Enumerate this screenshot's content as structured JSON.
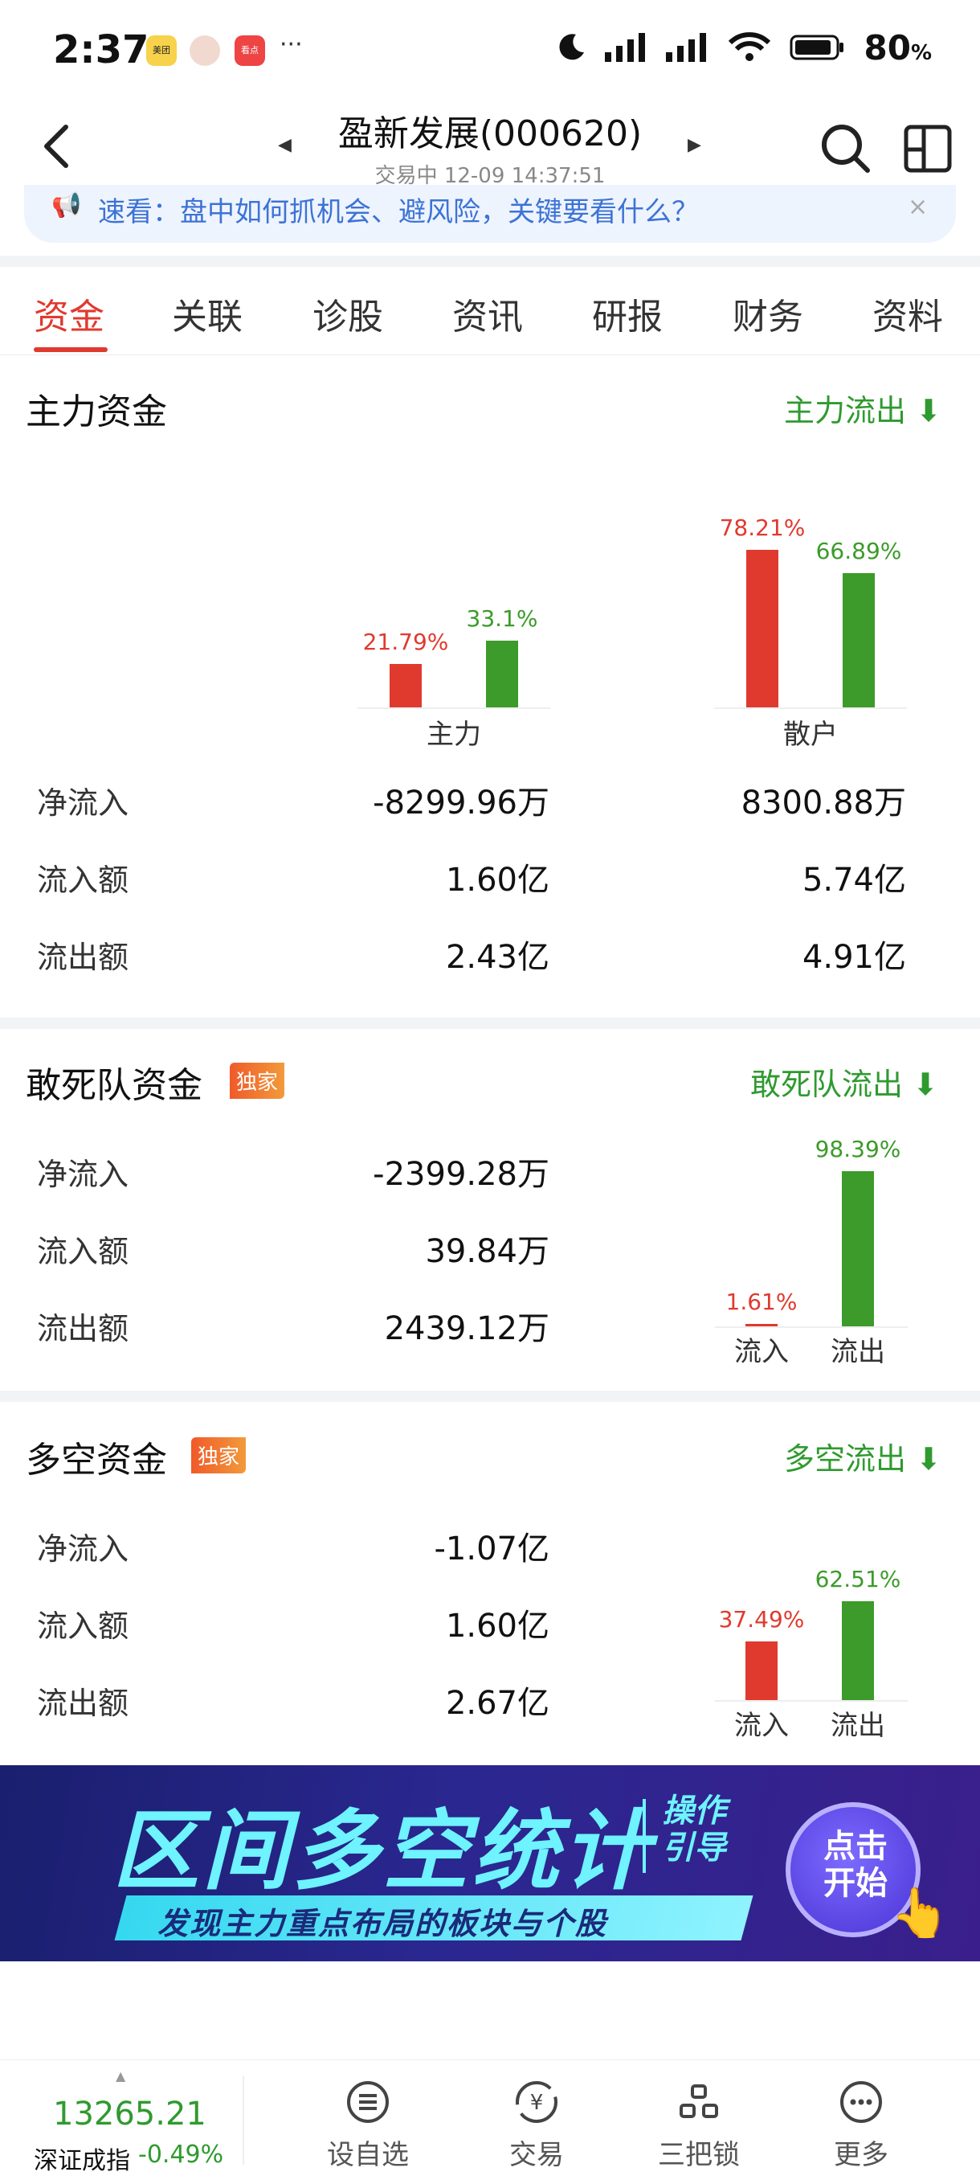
{
  "status_bar": {
    "time": "2:37",
    "notifications": [
      "美团",
      "看点"
    ],
    "more": "···",
    "battery": "80",
    "battery_unit": "%"
  },
  "header": {
    "title": "盈新发展(000620)",
    "subtitle": "交易中 12-09 14:37:51"
  },
  "notice": {
    "text": "速看：盘中如何抓机会、避风险，关键要看什么？"
  },
  "tabs": [
    "资金",
    "关联",
    "诊股",
    "资讯",
    "研报",
    "财务",
    "资料"
  ],
  "active_tab": 0,
  "main_funds": {
    "title": "主力资金",
    "link": "主力流出",
    "rows": [
      {
        "label": "净流入",
        "main": "-8299.96万",
        "retail": "8300.88万"
      },
      {
        "label": "流入额",
        "main": "1.60亿",
        "retail": "5.74亿"
      },
      {
        "label": "流出额",
        "main": "2.43亿",
        "retail": "4.91亿"
      }
    ]
  },
  "dare_funds": {
    "title": "敢死队资金",
    "badge": "独家",
    "link": "敢死队流出",
    "rows": [
      {
        "label": "净流入",
        "value": "-2399.28万"
      },
      {
        "label": "流入额",
        "value": "39.84万"
      },
      {
        "label": "流出额",
        "value": "2439.12万"
      }
    ]
  },
  "long_short_funds": {
    "title": "多空资金",
    "badge": "独家",
    "link": "多空流出",
    "rows": [
      {
        "label": "净流入",
        "value": "-1.07亿"
      },
      {
        "label": "流入额",
        "value": "1.60亿"
      },
      {
        "label": "流出额",
        "value": "2.67亿"
      }
    ]
  },
  "chart_data": [
    {
      "type": "bar",
      "categories": [
        "主力",
        "散户"
      ],
      "series": [
        {
          "values": [
            21.79,
            78.21
          ],
          "labels": [
            "21.79%",
            "78.21%"
          ],
          "color": "#e03a2f"
        },
        {
          "values": [
            33.1,
            66.89
          ],
          "labels": [
            "33.1%",
            "66.89%"
          ],
          "color": "#3c9b2a"
        }
      ],
      "ylim": [
        0,
        80
      ]
    },
    {
      "type": "bar",
      "categories": [
        "流入",
        "流出"
      ],
      "values": [
        1.61,
        98.39
      ],
      "labels": [
        "1.61%",
        "98.39%"
      ],
      "colors": [
        "#e03a2f",
        "#3c9b2a"
      ],
      "ylim": [
        0,
        100
      ]
    },
    {
      "type": "bar",
      "categories": [
        "流入",
        "流出"
      ],
      "values": [
        37.49,
        62.51
      ],
      "labels": [
        "37.49%",
        "62.51%"
      ],
      "colors": [
        "#e03a2f",
        "#3c9b2a"
      ],
      "ylim": [
        0,
        100
      ]
    }
  ],
  "ad": {
    "title": "区间多空统计",
    "tag": "操作引导",
    "subtitle": "发现主力重点布局的板块与个股",
    "button": "点击开始"
  },
  "bottom_bar": {
    "index_value": "13265.21",
    "index_name": "深证成指",
    "index_change": "-0.49%",
    "items": [
      "设自选",
      "交易",
      "三把锁",
      "更多"
    ]
  }
}
